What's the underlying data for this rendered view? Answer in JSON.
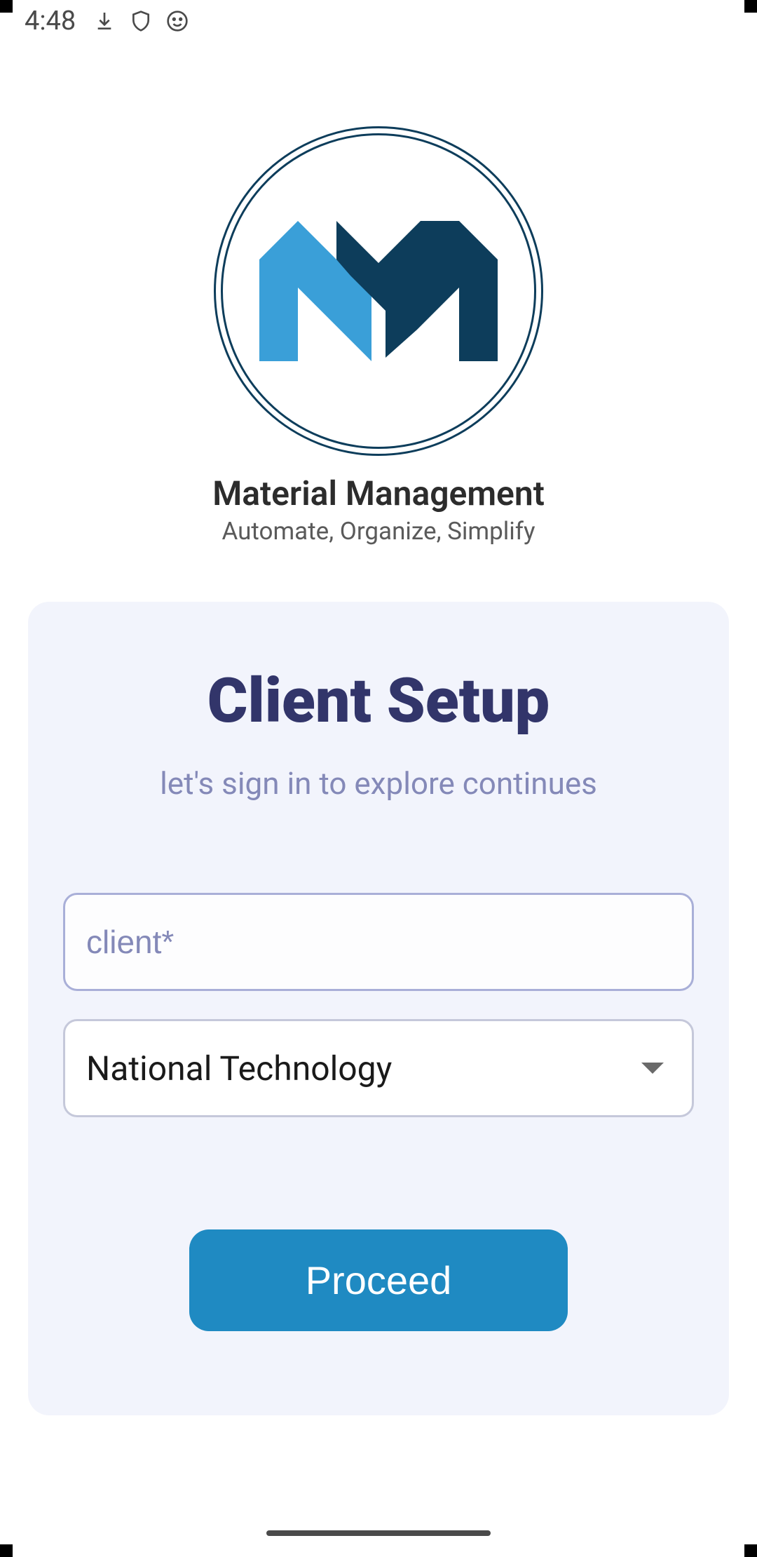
{
  "status_bar": {
    "time": "4:48",
    "icons": {
      "download": "download-icon",
      "shield": "shield-icon",
      "face": "face-icon"
    }
  },
  "branding": {
    "app_title": "Material Management",
    "app_subtitle": "Automate, Organize, Simplify"
  },
  "card": {
    "title": "Client Setup",
    "subtitle": "let's sign in to explore continues",
    "client_placeholder": "client*",
    "select_value": "National Technology",
    "proceed_label": "Proceed"
  },
  "colors": {
    "logo_dark": "#0d3d5b",
    "logo_light": "#1f8ac2",
    "card_bg": "#f2f4fc",
    "title_color": "#32356a",
    "subtitle_color": "#8489b8",
    "button_bg": "#1f8ac2"
  }
}
